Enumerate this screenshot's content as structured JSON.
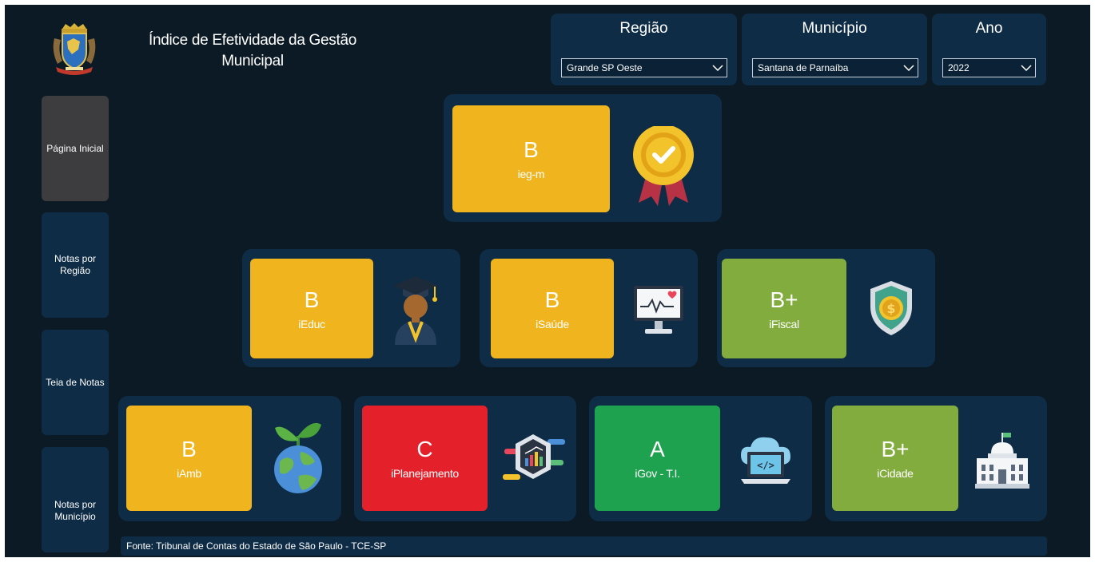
{
  "header": {
    "title_line1": "Índice de Efetividade da Gestão",
    "title_line2": "Municipal"
  },
  "filters": {
    "regiao": {
      "label": "Região",
      "value": "Grande SP Oeste"
    },
    "municipio": {
      "label": "Município",
      "value": "Santana de Parnaíba"
    },
    "ano": {
      "label": "Ano",
      "value": "2022"
    }
  },
  "sidebar": {
    "items": [
      {
        "label": "Página Inicial"
      },
      {
        "label": "Notas por Região"
      },
      {
        "label": "Teia de Notas"
      },
      {
        "label": "Notas por Município"
      }
    ]
  },
  "cards": {
    "iegm": {
      "grade": "B",
      "name": "ieg-m",
      "color": "#f0b41e",
      "icon": "award-medal-icon"
    },
    "ieduc": {
      "grade": "B",
      "name": "iEduc",
      "color": "#f0b41e",
      "icon": "graduate-icon"
    },
    "isaude": {
      "grade": "B",
      "name": "iSaúde",
      "color": "#f0b41e",
      "icon": "heart-monitor-icon"
    },
    "ifiscal": {
      "grade": "B+",
      "name": "iFiscal",
      "color": "#82ac3e",
      "icon": "money-shield-icon"
    },
    "iamb": {
      "grade": "B",
      "name": "iAmb",
      "color": "#f0b41e",
      "icon": "globe-plant-icon"
    },
    "iplanejamento": {
      "grade": "C",
      "name": "iPlanejamento",
      "color": "#e4202a",
      "icon": "analytics-chart-icon"
    },
    "igov": {
      "grade": "A",
      "name": "iGov - T.I.",
      "color": "#1ea24f",
      "icon": "cloud-laptop-icon"
    },
    "icidade": {
      "grade": "B+",
      "name": "iCidade",
      "color": "#82ac3e",
      "icon": "city-hall-icon"
    }
  },
  "footer": {
    "source": "Fonte: Tribunal de Contas do Estado de São Paulo - TCE-SP"
  }
}
